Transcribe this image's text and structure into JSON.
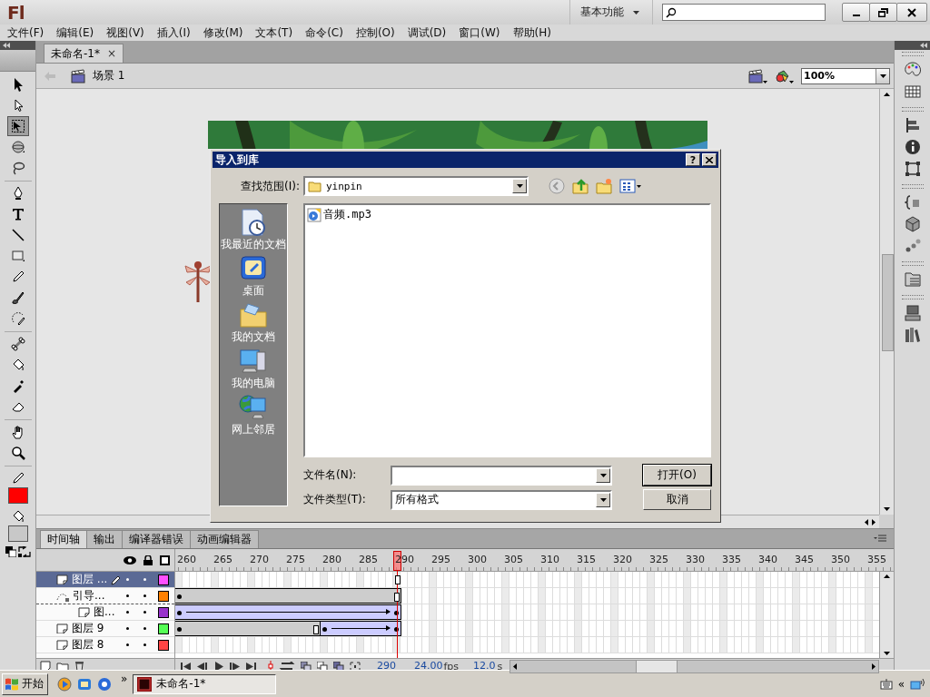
{
  "app": {
    "logo": "Fl",
    "workspace": "基本功能"
  },
  "menu": [
    "文件(F)",
    "编辑(E)",
    "视图(V)",
    "插入(I)",
    "修改(M)",
    "文本(T)",
    "命令(C)",
    "控制(O)",
    "调试(D)",
    "窗口(W)",
    "帮助(H)"
  ],
  "document_tabs": [
    {
      "label": "未命名-1*",
      "close": "×",
      "selected": true
    }
  ],
  "edit_bar": {
    "scene": "场景 1",
    "zoom": "100%"
  },
  "tools": [
    {
      "kind": "arrow",
      "selected": false
    },
    {
      "kind": "subselect",
      "selected": false
    },
    {
      "kind": "transform",
      "selected": true
    },
    {
      "kind": "sphere",
      "selected": false
    },
    {
      "kind": "lasso",
      "selected": false
    },
    {
      "kind": "pen",
      "selected": false
    },
    {
      "kind": "text",
      "selected": false
    },
    {
      "kind": "line",
      "selected": false
    },
    {
      "kind": "rect",
      "selected": false
    },
    {
      "kind": "pencil",
      "selected": false
    },
    {
      "kind": "brush",
      "selected": false
    },
    {
      "kind": "deco",
      "selected": false
    },
    {
      "kind": "bone",
      "selected": false
    },
    {
      "kind": "bucket",
      "selected": false
    },
    {
      "kind": "dropper",
      "selected": false
    },
    {
      "kind": "eraser",
      "selected": false
    },
    {
      "kind": "hand",
      "selected": false
    },
    {
      "kind": "zoom",
      "selected": false
    }
  ],
  "swatches": [
    {
      "kind": "stroke",
      "color": "#ff0000"
    },
    {
      "kind": "fill",
      "color": "#c8c8c8"
    }
  ],
  "timeline": {
    "tabs": [
      {
        "label": "时间轴",
        "selected": true
      },
      {
        "label": "输出",
        "selected": false
      },
      {
        "label": "编译器错误",
        "selected": false
      },
      {
        "label": "动画编辑器",
        "selected": false
      }
    ],
    "frame_ticks": [
      {
        "label": "260",
        "selected": false
      },
      {
        "label": "265",
        "selected": false
      },
      {
        "label": "270",
        "selected": false
      },
      {
        "label": "275",
        "selected": false
      },
      {
        "label": "280",
        "selected": false
      },
      {
        "label": "285",
        "selected": false
      },
      {
        "label": "290",
        "selected": true
      },
      {
        "label": "295",
        "selected": false
      },
      {
        "label": "300",
        "selected": false
      },
      {
        "label": "305",
        "selected": false
      },
      {
        "label": "310",
        "selected": false
      },
      {
        "label": "315",
        "selected": false
      },
      {
        "label": "320",
        "selected": false
      },
      {
        "label": "325",
        "selected": false
      },
      {
        "label": "330",
        "selected": false
      },
      {
        "label": "335",
        "selected": false
      },
      {
        "label": "340",
        "selected": false
      },
      {
        "label": "345",
        "selected": false
      },
      {
        "label": "350",
        "selected": false
      },
      {
        "label": "355",
        "selected": false
      }
    ],
    "layers": [
      {
        "name": "图层 ...",
        "kind": "layer",
        "selected": true,
        "color": "#ff4fff",
        "frames": [
          {
            "kind": "blank"
          }
        ]
      },
      {
        "name": "引导...",
        "kind": "guide",
        "selected": false,
        "color": "#ff8000",
        "frames": [
          {
            "kind": "static"
          }
        ],
        "children": [
          {
            "name": "图...",
            "kind": "layer",
            "selected": false,
            "color": "#9933cc",
            "frames": [
              {
                "kind": "tween"
              }
            ]
          }
        ]
      },
      {
        "name": "图层 9",
        "kind": "layer",
        "selected": false,
        "color": "#55ff55",
        "frames": [
          {
            "kind": "static"
          },
          {
            "kind": "tween"
          }
        ]
      },
      {
        "name": "图层 8",
        "kind": "layer",
        "selected": false,
        "color": "#ff4444"
      }
    ],
    "current_frame": "290",
    "frame_rate": "24.00",
    "frame_rate_unit": "fps",
    "elapsed": "12.0",
    "elapsed_unit": "s"
  },
  "dialog": {
    "title": "导入到库",
    "help": "?",
    "look_in_label": "查找范围(I):",
    "look_in": "yinpin",
    "places": [
      {
        "kind": "recent",
        "label": "我最近的文档"
      },
      {
        "kind": "desktop",
        "label": "桌面"
      },
      {
        "kind": "documents",
        "label": "我的文档"
      },
      {
        "kind": "computer",
        "label": "我的电脑"
      },
      {
        "kind": "network",
        "label": "网上邻居"
      }
    ],
    "files": [
      {
        "name": "音频.mp3",
        "selected": false
      }
    ],
    "file_name_label": "文件名(N):",
    "file_type_label": "文件类型(T):",
    "file_type": "所有格式",
    "buttons": [
      {
        "label": "打开(O)",
        "kind": "default"
      },
      {
        "label": "取消",
        "kind": "normal"
      }
    ]
  },
  "taskbar": {
    "start": "开始",
    "more": "»",
    "tasks": [
      {
        "label": "未命名-1*",
        "selected": true
      }
    ],
    "tray_toggle": "«"
  }
}
